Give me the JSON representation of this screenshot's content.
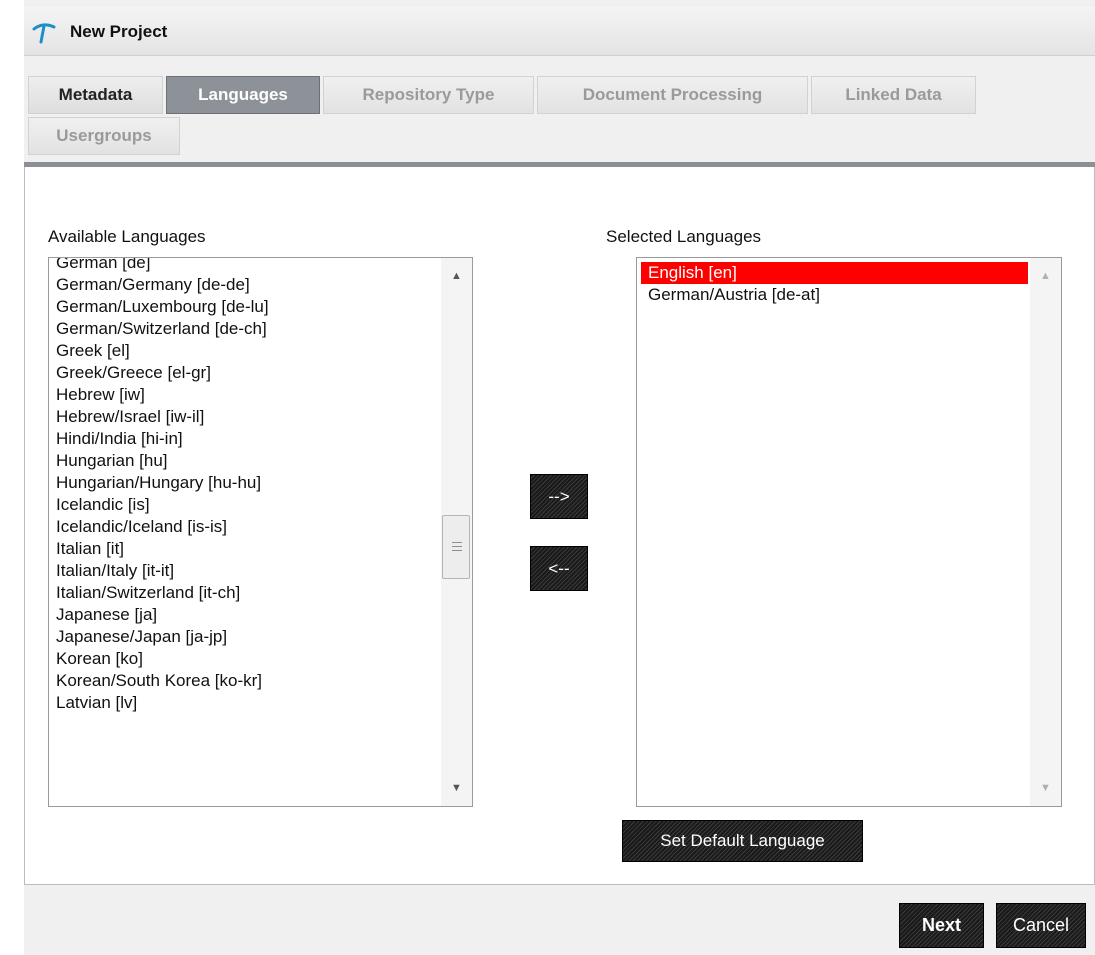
{
  "window": {
    "title": "New Project",
    "logo_icon": "umbrella-logo-icon"
  },
  "tabs": [
    {
      "label": "Metadata",
      "state": "normal"
    },
    {
      "label": "Languages",
      "state": "active"
    },
    {
      "label": "Repository Type",
      "state": "disabled"
    },
    {
      "label": "Document Processing",
      "state": "disabled"
    },
    {
      "label": "Linked Data",
      "state": "disabled"
    },
    {
      "label": "Usergroups",
      "state": "disabled"
    }
  ],
  "available": {
    "label": "Available Languages",
    "items": [
      "German [de]",
      "German/Germany [de-de]",
      "German/Luxembourg [de-lu]",
      "German/Switzerland [de-ch]",
      "Greek [el]",
      "Greek/Greece [el-gr]",
      "Hebrew [iw]",
      "Hebrew/Israel [iw-il]",
      "Hindi/India [hi-in]",
      "Hungarian [hu]",
      "Hungarian/Hungary [hu-hu]",
      "Icelandic [is]",
      "Icelandic/Iceland [is-is]",
      "Italian [it]",
      "Italian/Italy [it-it]",
      "Italian/Switzerland [it-ch]",
      "Japanese [ja]",
      "Japanese/Japan [ja-jp]",
      "Korean [ko]",
      "Korean/South Korea [ko-kr]",
      "Latvian [lv]"
    ]
  },
  "selected": {
    "label": "Selected Languages",
    "items": [
      "English [en]",
      "German/Austria [de-at]"
    ],
    "selected_index": 0,
    "highlight_color": "#ff0000"
  },
  "buttons": {
    "add": "-->",
    "remove": "<--",
    "set_default": "Set Default Language",
    "next": "Next",
    "cancel": "Cancel"
  },
  "colors": {
    "active_tab": "#8c9297",
    "button": "#1f1f1f"
  }
}
